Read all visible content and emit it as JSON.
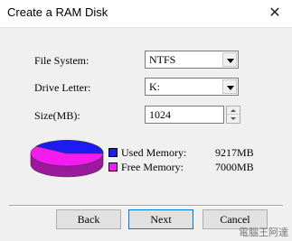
{
  "window": {
    "title": "Create a RAM Disk",
    "close_glyph": "✕"
  },
  "form": {
    "file_system_label": "File System:",
    "file_system_value": "NTFS",
    "drive_letter_label": "Drive Letter:",
    "drive_letter_value": "K:",
    "size_label": "Size(MB):",
    "size_value": "1024"
  },
  "memory": {
    "used_label": "Used Memory:",
    "used_value": "9217MB",
    "free_label": "Free Memory:",
    "free_value": "7000MB",
    "used_color": "#1c1cf0",
    "free_color": "#f21cf0"
  },
  "buttons": {
    "back": "Back",
    "next": "Next",
    "cancel": "Cancel"
  },
  "watermark": "電腦王阿達"
}
